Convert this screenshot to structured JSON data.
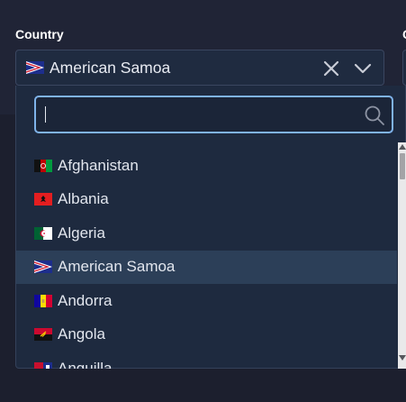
{
  "field": {
    "label": "Country",
    "next_label": "C",
    "selected": {
      "label": "American Samoa",
      "flag": "american-samoa-flag-icon"
    }
  },
  "search": {
    "value": "",
    "placeholder": ""
  },
  "options": [
    {
      "label": "Afghanistan",
      "flag": "afghanistan-flag-icon",
      "highlighted": false
    },
    {
      "label": "Albania",
      "flag": "albania-flag-icon",
      "highlighted": false
    },
    {
      "label": "Algeria",
      "flag": "algeria-flag-icon",
      "highlighted": false
    },
    {
      "label": "American Samoa",
      "flag": "american-samoa-flag-icon",
      "highlighted": true
    },
    {
      "label": "Andorra",
      "flag": "andorra-flag-icon",
      "highlighted": false
    },
    {
      "label": "Angola",
      "flag": "angola-flag-icon",
      "highlighted": false
    },
    {
      "label": "Anguilla",
      "flag": "anguilla-flag-icon",
      "highlighted": false
    }
  ],
  "icons": {
    "clear": "close-icon",
    "toggle": "chevron-down-icon",
    "search": "search-icon"
  },
  "colors": {
    "background": "#1f2233",
    "control": "#1f2b40",
    "focus_border": "#7fb3ea",
    "highlight": "#2c3f58",
    "text": "#e2e6ee"
  }
}
